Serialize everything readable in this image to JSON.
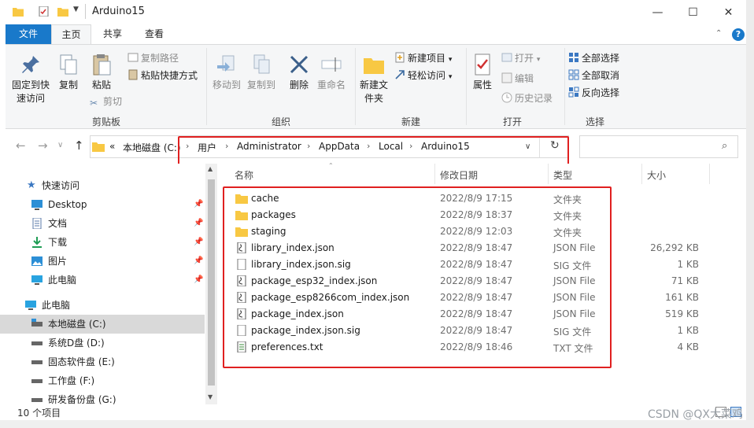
{
  "window": {
    "title": "Arduino15",
    "minimize_glyph": "—",
    "maximize_glyph": "☐",
    "close_glyph": "✕"
  },
  "ribbon_tabs": [
    "文件",
    "主页",
    "共享",
    "查看"
  ],
  "ribbon": {
    "clipboard": {
      "label": "剪贴板",
      "pin_quick_access": "固定到快速访问",
      "copy": "复制",
      "paste": "粘贴",
      "copy_path": "复制路径",
      "paste_shortcut": "粘贴快捷方式",
      "cut": "剪切"
    },
    "organize": {
      "label": "组织",
      "move_to": "移动到",
      "copy_to": "复制到",
      "delete": "删除",
      "rename": "重命名"
    },
    "new": {
      "label": "新建",
      "new_folder": "新建文件夹",
      "new_item": "新建项目",
      "easy_access": "轻松访问"
    },
    "open": {
      "label": "打开",
      "properties": "属性",
      "open": "打开",
      "edit": "编辑",
      "history": "历史记录"
    },
    "select": {
      "label": "选择",
      "select_all": "全部选择",
      "select_none": "全部取消",
      "invert": "反向选择"
    }
  },
  "address": {
    "overflow": "«",
    "crumbs": [
      "本地磁盘 (C:)",
      "用户",
      "Administrator",
      "AppData",
      "Local",
      "Arduino15"
    ],
    "separator": "›"
  },
  "nav": {
    "items": [
      {
        "label": "快速访问",
        "icon": "star-icon",
        "pinned": false
      },
      {
        "label": "Desktop",
        "icon": "desktop-icon",
        "pinned": true
      },
      {
        "label": "文档",
        "icon": "document-icon",
        "pinned": true
      },
      {
        "label": "下载",
        "icon": "download-icon",
        "pinned": true
      },
      {
        "label": "图片",
        "icon": "picture-icon",
        "pinned": true
      },
      {
        "label": "此电脑",
        "icon": "computer-icon",
        "pinned": true
      },
      {
        "label": "此电脑",
        "icon": "computer-icon",
        "pinned": false
      },
      {
        "label": "本地磁盘 (C:)",
        "icon": "drive-icon",
        "pinned": false,
        "selected": true
      },
      {
        "label": "系统D盘 (D:)",
        "icon": "drive-icon",
        "pinned": false
      },
      {
        "label": "固态软件盘 (E:)",
        "icon": "drive-icon",
        "pinned": false
      },
      {
        "label": "工作盘 (F:)",
        "icon": "drive-icon",
        "pinned": false
      },
      {
        "label": "研发备份盘 (G:)",
        "icon": "drive-icon",
        "pinned": false
      }
    ]
  },
  "columns": {
    "name": "名称",
    "date": "修改日期",
    "type": "类型",
    "size": "大小"
  },
  "files": [
    {
      "name": "cache",
      "date": "2022/8/9 17:15",
      "type": "文件夹",
      "size": "",
      "icon": "folder-icon"
    },
    {
      "name": "packages",
      "date": "2022/8/9 18:37",
      "type": "文件夹",
      "size": "",
      "icon": "folder-icon"
    },
    {
      "name": "staging",
      "date": "2022/8/9 12:03",
      "type": "文件夹",
      "size": "",
      "icon": "folder-icon"
    },
    {
      "name": "library_index.json",
      "date": "2022/8/9 18:47",
      "type": "JSON File",
      "size": "26,292 KB",
      "icon": "json-file-icon"
    },
    {
      "name": "library_index.json.sig",
      "date": "2022/8/9 18:47",
      "type": "SIG 文件",
      "size": "1 KB",
      "icon": "file-icon"
    },
    {
      "name": "package_esp32_index.json",
      "date": "2022/8/9 18:47",
      "type": "JSON File",
      "size": "71 KB",
      "icon": "json-file-icon"
    },
    {
      "name": "package_esp8266com_index.json",
      "date": "2022/8/9 18:47",
      "type": "JSON File",
      "size": "161 KB",
      "icon": "json-file-icon"
    },
    {
      "name": "package_index.json",
      "date": "2022/8/9 18:47",
      "type": "JSON File",
      "size": "519 KB",
      "icon": "json-file-icon"
    },
    {
      "name": "package_index.json.sig",
      "date": "2022/8/9 18:47",
      "type": "SIG 文件",
      "size": "1 KB",
      "icon": "file-icon"
    },
    {
      "name": "preferences.txt",
      "date": "2022/8/9 18:46",
      "type": "TXT 文件",
      "size": "4 KB",
      "icon": "text-file-icon"
    }
  ],
  "status": {
    "count": "10 个项目"
  },
  "watermark": "CSDN @QX大菜鸡",
  "colors": {
    "accent": "#1979ca",
    "highlight": "#e02020",
    "folder": "#f8c843"
  }
}
